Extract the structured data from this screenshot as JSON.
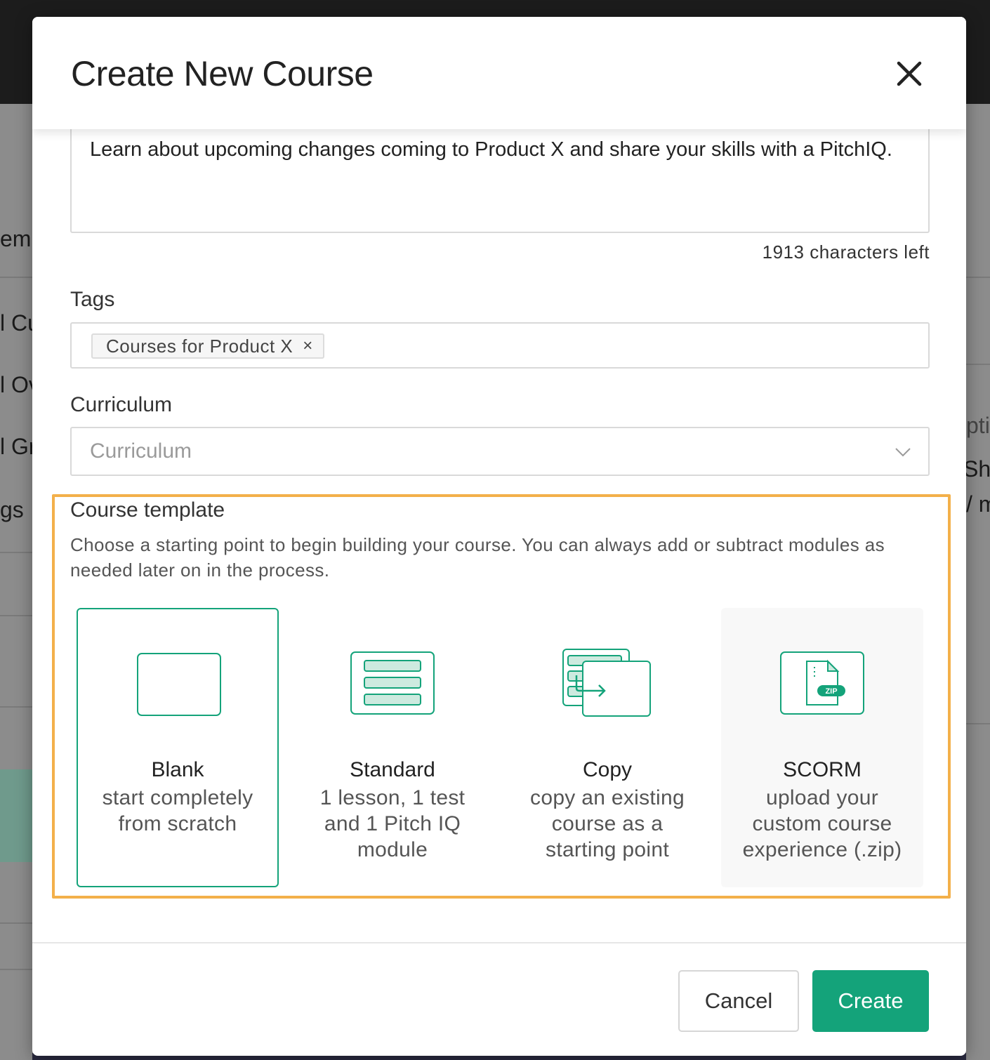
{
  "background": {
    "fragments": [
      "em",
      "l Cu",
      "l Ov",
      "l Gr",
      "gs",
      "pti",
      "Sho",
      "/ m"
    ]
  },
  "modal": {
    "title": "Create New Course",
    "description_text": "Learn about upcoming changes coming to Product X and share your skills with a PitchIQ.",
    "characters_left": "1913 characters left",
    "tags": {
      "label": "Tags",
      "chips": [
        {
          "label": "Courses for Product X",
          "remove": "×"
        }
      ]
    },
    "curriculum": {
      "label": "Curriculum",
      "placeholder": "Curriculum"
    },
    "course_template": {
      "title": "Course template",
      "help": "Choose a starting point to begin building your course. You can always add or subtract modules as needed later on in the process.",
      "options": [
        {
          "name": "Blank",
          "description": "start completely from scratch",
          "icon": "blank-template-icon",
          "selected": true
        },
        {
          "name": "Standard",
          "description": "1 lesson, 1 test and 1 Pitch IQ module",
          "icon": "standard-template-icon",
          "selected": false
        },
        {
          "name": "Copy",
          "description": "copy an existing course as a starting point",
          "icon": "copy-template-icon",
          "selected": false
        },
        {
          "name": "SCORM",
          "description": "upload your custom course experience (.zip)",
          "icon": "zip-file-icon",
          "selected": false,
          "zip_badge": "ZIP"
        }
      ]
    },
    "footer": {
      "cancel_label": "Cancel",
      "create_label": "Create"
    }
  },
  "colors": {
    "accent": "#14a37a",
    "highlight_border": "#f3b04a",
    "icon_fill": "#cdeadf"
  }
}
